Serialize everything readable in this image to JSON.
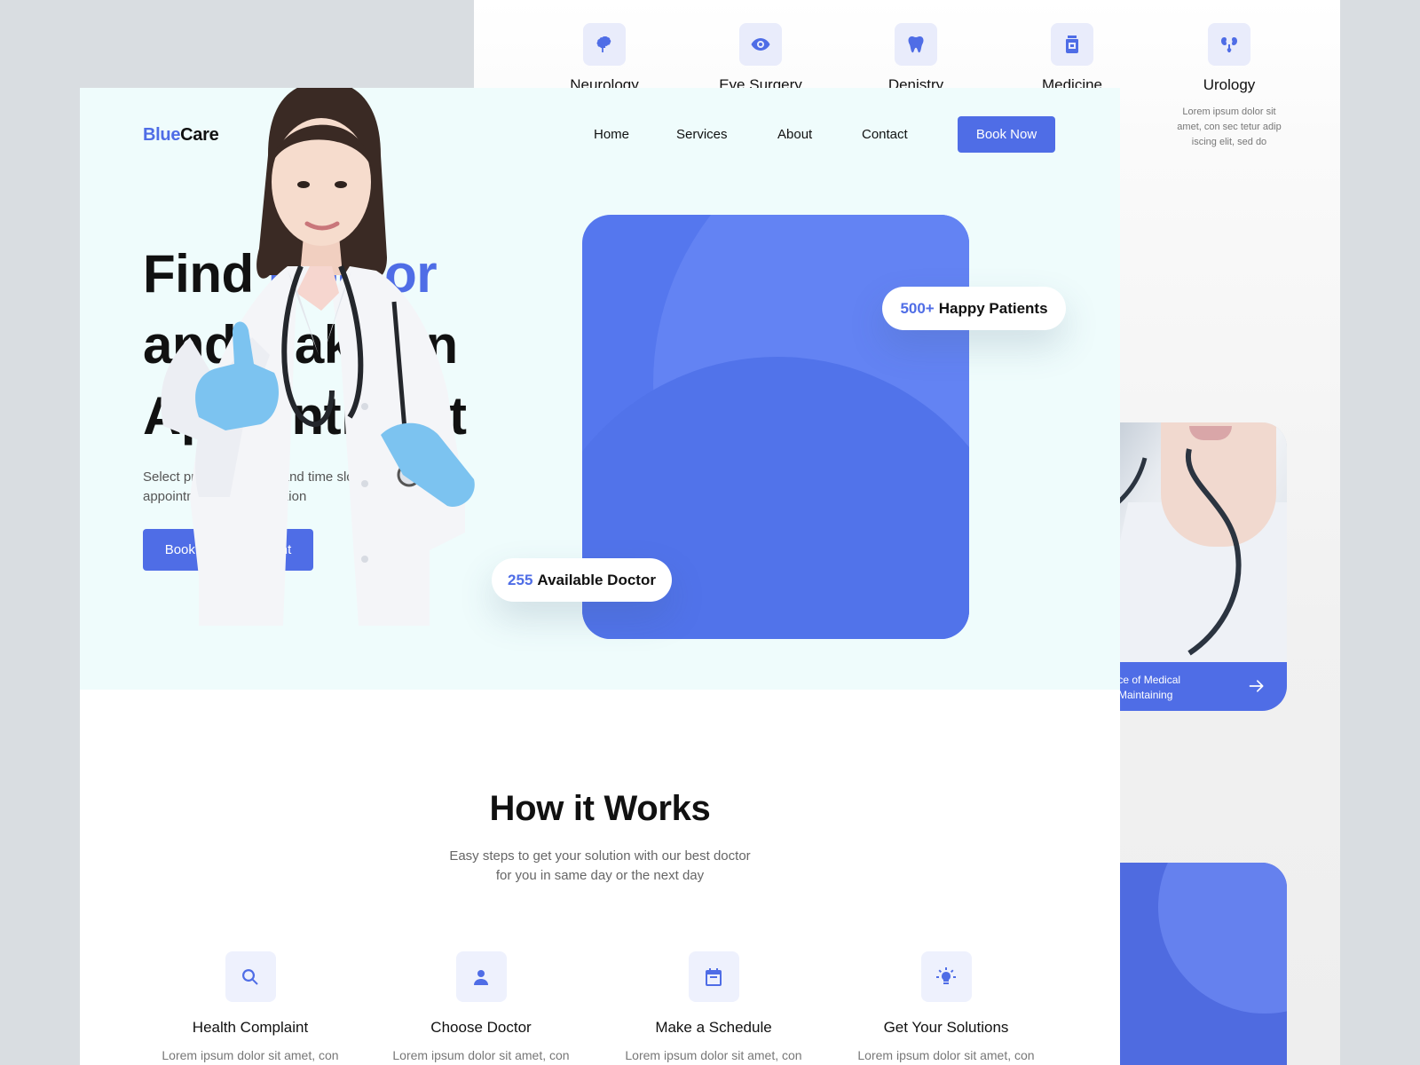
{
  "brand": {
    "part1": "Blue",
    "part2": "Care"
  },
  "nav": {
    "items": [
      "Home",
      "Services",
      "About",
      "Contact"
    ],
    "cta": "Book Now"
  },
  "hero": {
    "title_line1_a": "Find",
    "title_line1_b": "Doctor",
    "title_line2": "and Make an",
    "title_line3": "Appointment",
    "subtitle": "Select preferred doctor and time slot to book appointment or consultation",
    "cta": "Book an Appointment",
    "stat_patients": {
      "number": "500+",
      "label": "Happy Patients"
    },
    "stat_doctors": {
      "number": "255",
      "label": "Available Doctor"
    }
  },
  "how": {
    "title": "How it Works",
    "subtitle_line1": "Easy steps to get your solution with our best doctor",
    "subtitle_line2": "for you in same day or the next day",
    "steps": [
      {
        "icon": "search-icon",
        "title": "Health Complaint",
        "desc": "Lorem ipsum dolor sit amet, con"
      },
      {
        "icon": "user-icon",
        "title": "Choose Doctor",
        "desc": "Lorem ipsum dolor sit amet, con"
      },
      {
        "icon": "calendar-icon",
        "title": "Make a Schedule",
        "desc": "Lorem ipsum dolor sit amet, con"
      },
      {
        "icon": "lightbulb-icon",
        "title": "Get Your Solutions",
        "desc": "Lorem ipsum dolor sit amet, con"
      }
    ]
  },
  "back_page": {
    "services": [
      {
        "icon": "brain-icon",
        "name": "Neurology"
      },
      {
        "icon": "eye-icon",
        "name": "Eye Surgery"
      },
      {
        "icon": "tooth-icon",
        "name": "Denistry"
      },
      {
        "icon": "medicine-bottle-icon",
        "name": "Medicine"
      },
      {
        "icon": "kidney-icon",
        "name": "Urology",
        "desc": "Lorem ipsum dolor sit amet, con sec tetur adip iscing elit, sed do"
      }
    ],
    "article_card": {
      "line1": "ance of Medical",
      "line2": "or Maintaining"
    }
  },
  "colors": {
    "accent": "#4f6de6",
    "hero_bg": "#effcfc",
    "card_blue": "#5577ee"
  }
}
